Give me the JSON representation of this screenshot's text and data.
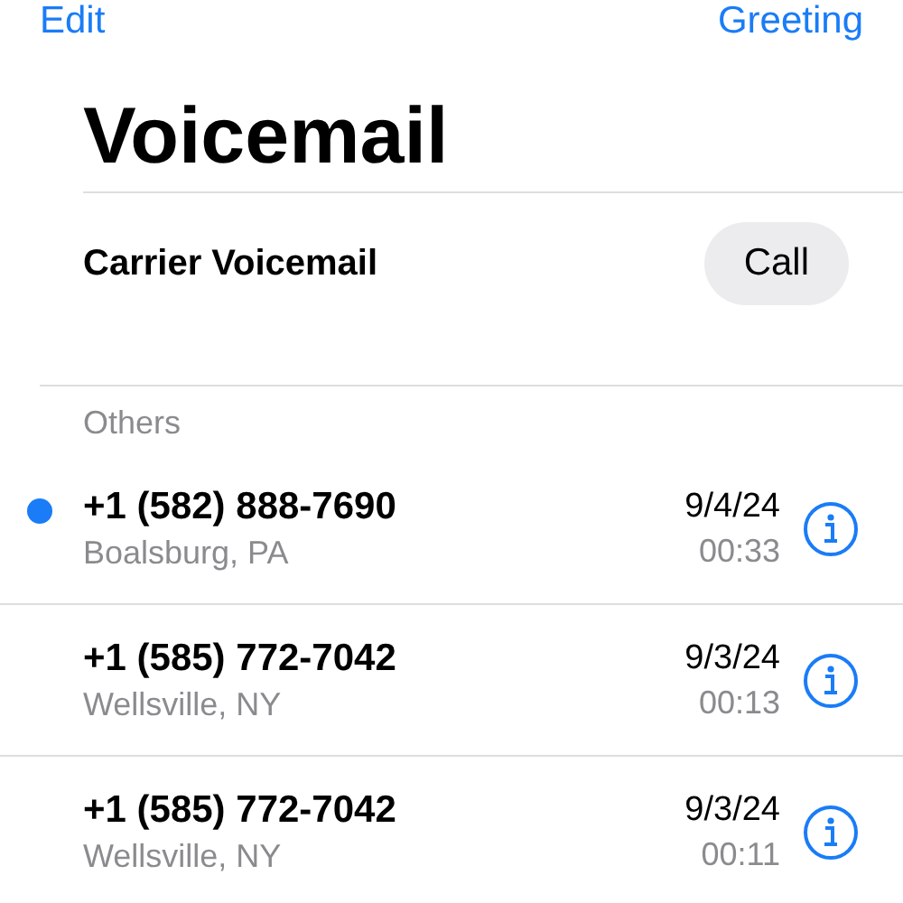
{
  "nav": {
    "left": "Edit",
    "right": "Greeting"
  },
  "title": "Voicemail",
  "carrier": {
    "label": "Carrier Voicemail",
    "button": "Call"
  },
  "section": "Others",
  "messages": [
    {
      "number": "+1 (582) 888-7690",
      "location": "Boalsburg, PA",
      "date": "9/4/24",
      "duration": "00:33",
      "unread": true
    },
    {
      "number": "+1 (585) 772-7042",
      "location": "Wellsville, NY",
      "date": "9/3/24",
      "duration": "00:13",
      "unread": false
    },
    {
      "number": "+1 (585) 772-7042",
      "location": "Wellsville, NY",
      "date": "9/3/24",
      "duration": "00:11",
      "unread": false
    }
  ]
}
